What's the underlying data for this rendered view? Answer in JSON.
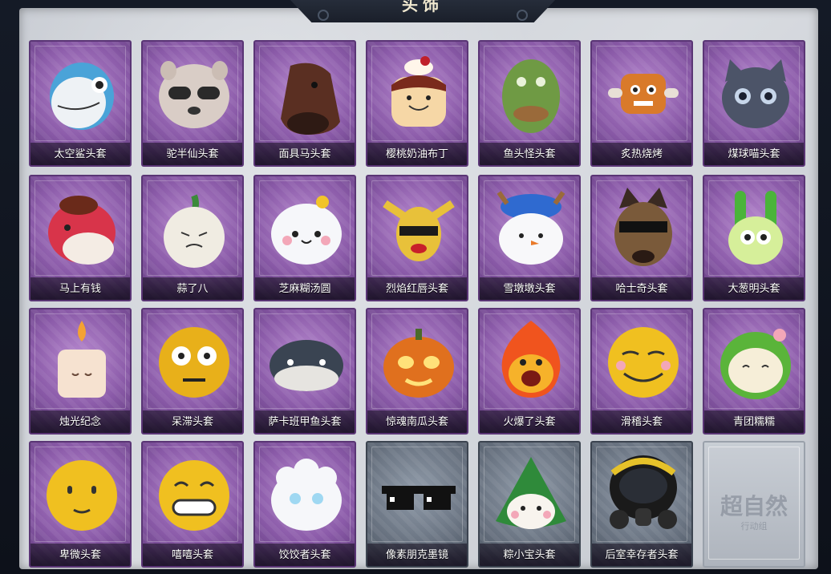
{
  "screen": {
    "title": "头饰"
  },
  "items": [
    {
      "name": "太空鲨头套",
      "rarity": "purple",
      "icon": "shark-head-icon"
    },
    {
      "name": "驼半仙头套",
      "rarity": "purple",
      "icon": "alpaca-sunglasses-head-icon"
    },
    {
      "name": "面具马头套",
      "rarity": "purple",
      "icon": "horse-mask-icon"
    },
    {
      "name": "樱桃奶油布丁",
      "rarity": "purple",
      "icon": "cherry-pudding-icon"
    },
    {
      "name": "鱼头怪头套",
      "rarity": "purple",
      "icon": "fish-head-icon"
    },
    {
      "name": "炙热烧烤",
      "rarity": "purple",
      "icon": "grilled-meat-icon"
    },
    {
      "name": "煤球喵头套",
      "rarity": "purple",
      "icon": "grey-cat-head-icon"
    },
    {
      "name": "马上有钱",
      "rarity": "purple",
      "icon": "red-horse-head-icon"
    },
    {
      "name": "蒜了八",
      "rarity": "purple",
      "icon": "garlic-head-icon"
    },
    {
      "name": "芝麻糊汤圆",
      "rarity": "purple",
      "icon": "rice-ball-icon"
    },
    {
      "name": "烈焰红唇头套",
      "rarity": "purple",
      "icon": "yellow-mouse-sunglasses-icon"
    },
    {
      "name": "雪墩墩头套",
      "rarity": "purple",
      "icon": "snowman-reindeer-icon"
    },
    {
      "name": "哈士奇头套",
      "rarity": "purple",
      "icon": "husky-sunglasses-icon"
    },
    {
      "name": "大葱明头套",
      "rarity": "purple",
      "icon": "green-onion-icon"
    },
    {
      "name": "烛光纪念",
      "rarity": "purple",
      "icon": "candle-icon"
    },
    {
      "name": "呆滞头套",
      "rarity": "purple",
      "icon": "dazed-emoji-icon"
    },
    {
      "name": "萨卡班甲鱼头套",
      "rarity": "purple",
      "icon": "fossil-fish-icon"
    },
    {
      "name": "惊魂南瓜头套",
      "rarity": "purple",
      "icon": "pumpkin-lantern-icon"
    },
    {
      "name": "火爆了头套",
      "rarity": "purple",
      "icon": "fire-spirit-icon"
    },
    {
      "name": "滑稽头套",
      "rarity": "purple",
      "icon": "smirk-emoji-icon"
    },
    {
      "name": "青团糯糯",
      "rarity": "purple",
      "icon": "green-dumpling-icon"
    },
    {
      "name": "卑微头套",
      "rarity": "purple",
      "icon": "humble-emoji-icon"
    },
    {
      "name": "嘻嘻头套",
      "rarity": "purple",
      "icon": "grin-emoji-icon"
    },
    {
      "name": "饺饺者头套",
      "rarity": "purple",
      "icon": "dumpling-cloud-icon"
    },
    {
      "name": "像素朋克墨镜",
      "rarity": "grey",
      "icon": "pixel-sunglasses-icon"
    },
    {
      "name": "粽小宝头套",
      "rarity": "grey",
      "icon": "zongzi-head-icon"
    },
    {
      "name": "后室幸存者头套",
      "rarity": "grey",
      "icon": "gas-mask-helmet-icon"
    },
    {
      "name": "",
      "rarity": "blank",
      "icon": "empty-slot-icon"
    }
  ],
  "watermark": {
    "main": "超自然",
    "sub": "行动组"
  },
  "colors": {
    "purple_card": "#8a5aa8",
    "grey_card": "#6c7684",
    "panel": "#d2d5da"
  }
}
